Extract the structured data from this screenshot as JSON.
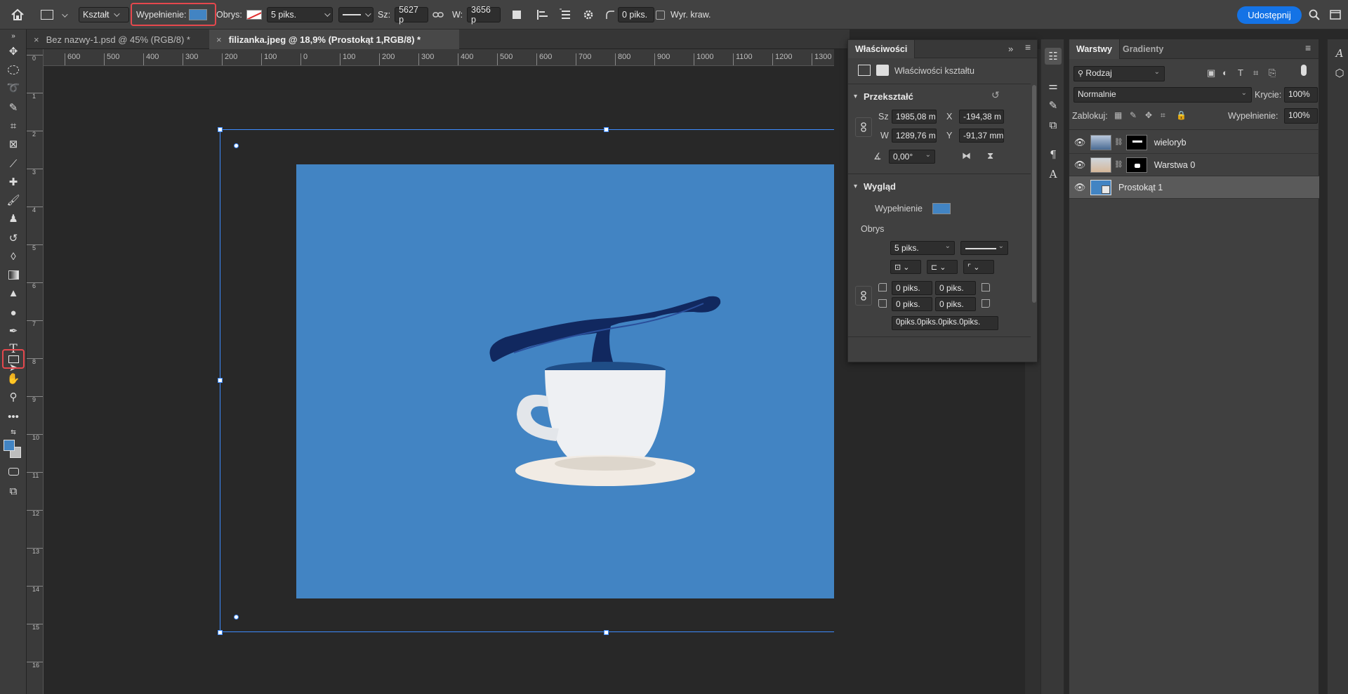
{
  "optbar": {
    "tool_mode": "Kształt",
    "fill_label": "Wypełnienie:",
    "fill_color": "#4284c3",
    "stroke_label": "Obrys:",
    "stroke_width": "5 piks.",
    "width_label": "Sz:",
    "width_value": "5627 p",
    "height_label": "W:",
    "height_value": "3656 p",
    "radius_value": "0 piks.",
    "align_edges_label": "Wyr. kraw.",
    "share_label": "Udostępnij"
  },
  "tabs": [
    {
      "label": "Bez nazwy-1.psd @ 45% (RGB/8) *",
      "active": false
    },
    {
      "label": "filizanka.jpeg @ 18,9% (Prostokąt 1,RGB/8) *",
      "active": true
    }
  ],
  "ruler": {
    "h": [
      "600",
      "500",
      "400",
      "300",
      "200",
      "100",
      "0",
      "100",
      "200",
      "300",
      "400",
      "500",
      "600",
      "700",
      "800",
      "900",
      "1000",
      "1100",
      "1200",
      "1300"
    ],
    "v": [
      "0",
      "1",
      "2",
      "3",
      "4",
      "5",
      "6",
      "7",
      "8",
      "9",
      "10",
      "11",
      "12",
      "13",
      "14",
      "15",
      "16",
      "17"
    ]
  },
  "properties": {
    "tab_label": "Właściwości",
    "subtitle": "Właściwości kształtu",
    "transform_title": "Przekształć",
    "w_label": "Sz",
    "w_value": "1985,08 m",
    "x_label": "X",
    "x_value": "-194,38 m",
    "h_label": "W",
    "h_value": "1289,76 m",
    "y_label": "Y",
    "y_value": "-91,37 mm",
    "angle_value": "0,00°",
    "appearance_title": "Wygląd",
    "fill_label": "Wypełnienie",
    "stroke_label": "Obrys",
    "stroke_width": "5 piks.",
    "corner_tl": "0 piks.",
    "corner_tr": "0 piks.",
    "corner_bl": "0 piks.",
    "corner_br": "0 piks.",
    "corners_summary": "0piks.0piks.0piks.0piks."
  },
  "layers_panel": {
    "tab_layers": "Warstwy",
    "tab_gradients": "Gradienty",
    "filter_label": "Rodzaj",
    "blend_mode": "Normalnie",
    "opacity_label": "Krycie:",
    "opacity_value": "100%",
    "lock_label": "Zablokuj:",
    "fill_label": "Wypełnienie:",
    "fill_value": "100%",
    "layers": [
      {
        "name": "wieloryb",
        "selected": false
      },
      {
        "name": "Warstwa 0",
        "selected": false
      },
      {
        "name": "Prostokąt 1",
        "selected": true
      }
    ]
  },
  "colors": {
    "shape_fill": "#4284c3",
    "accent": "#1473e6",
    "highlight": "#e5484d"
  }
}
